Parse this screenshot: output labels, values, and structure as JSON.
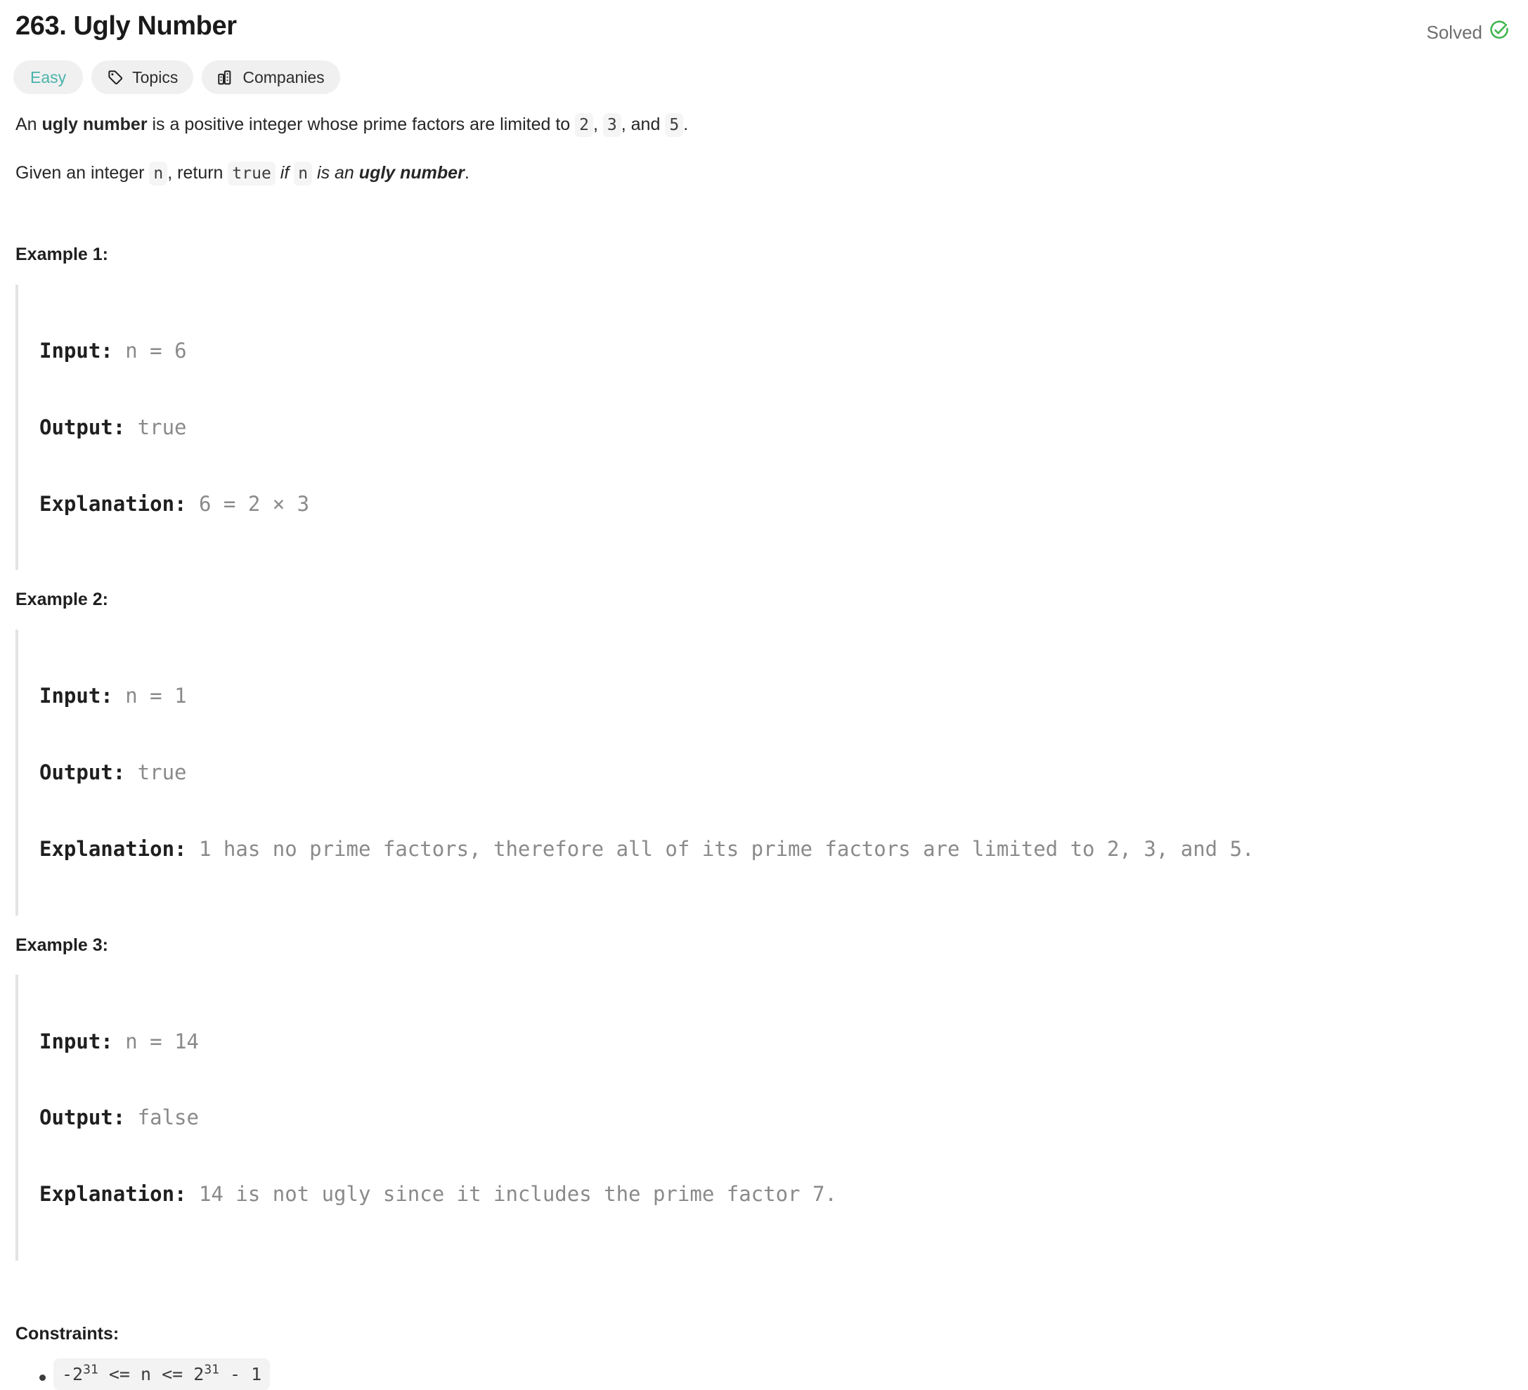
{
  "header": {
    "title": "263. Ugly Number",
    "status_label": "Solved",
    "status_icon": "check-circle-icon",
    "status_color": "#3cb44a"
  },
  "tags": [
    {
      "label": "Easy",
      "icon": null,
      "color": "#4ab3ab"
    },
    {
      "label": "Topics",
      "icon": "tag-icon",
      "color": "#2c2c2c"
    },
    {
      "label": "Companies",
      "icon": "building-icon",
      "color": "#2c2c2c"
    }
  ],
  "description": {
    "paragraph1": {
      "t1": "An ",
      "b1": "ugly number",
      "t2": " is a positive integer whose prime factors are limited to ",
      "c1": "2",
      "t3": ", ",
      "c2": "3",
      "t4": ", and ",
      "c3": "5",
      "t5": "."
    },
    "paragraph2": {
      "t1": "Given an integer ",
      "c1": "n",
      "t2": ", return ",
      "c2": "true",
      "t3": " ",
      "i1": "if",
      "t4": " ",
      "c3": "n",
      "t5": " ",
      "i2": "is an ",
      "bi1": "ugly number",
      "t6": "."
    }
  },
  "examples": [
    {
      "heading": "Example 1:",
      "input_label": "Input:",
      "input_value": " n = 6",
      "output_label": "Output:",
      "output_value": " true",
      "explanation_label": "Explanation:",
      "explanation_value": " 6 = 2 × 3"
    },
    {
      "heading": "Example 2:",
      "input_label": "Input:",
      "input_value": " n = 1",
      "output_label": "Output:",
      "output_value": " true",
      "explanation_label": "Explanation:",
      "explanation_value": " 1 has no prime factors, therefore all of its prime factors are limited to 2, 3, and 5."
    },
    {
      "heading": "Example 3:",
      "input_label": "Input:",
      "input_value": " n = 14",
      "output_label": "Output:",
      "output_value": " false",
      "explanation_label": "Explanation:",
      "explanation_value": " 14 is not ugly since it includes the prime factor 7."
    }
  ],
  "constraints": {
    "heading": "Constraints:",
    "items": [
      {
        "prefix": "-2",
        "exp1": "31",
        "middle": " <= n <= 2",
        "exp2": "31",
        "suffix": " - 1"
      }
    ]
  }
}
